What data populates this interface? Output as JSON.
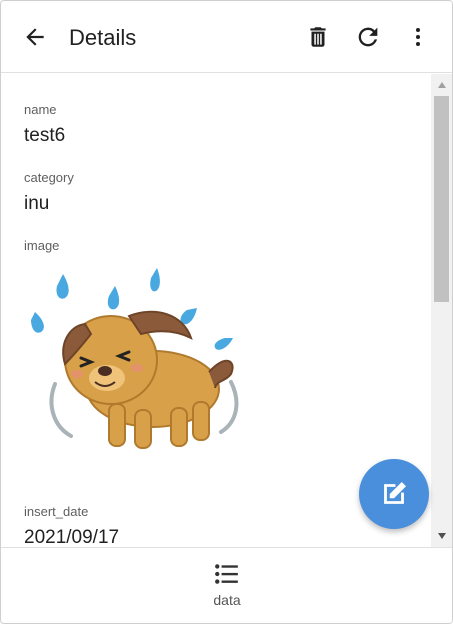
{
  "app": {
    "title": "Details"
  },
  "toolbar": {
    "back_icon": "arrow-back-icon",
    "delete_icon": "trash-icon",
    "refresh_icon": "refresh-icon",
    "more_icon": "more-vert-icon"
  },
  "record": {
    "fields": [
      {
        "label": "name",
        "value": "test6"
      },
      {
        "label": "category",
        "value": "inu"
      },
      {
        "label": "image",
        "value": ""
      },
      {
        "label": "insert_date",
        "value": "2021/09/17"
      }
    ]
  },
  "fab": {
    "icon": "edit-icon",
    "color": "#4a8fdc"
  },
  "bottom_nav": {
    "items": [
      {
        "label": "data",
        "icon": "list-icon"
      }
    ]
  },
  "colors": {
    "accent": "#4a8fdc",
    "droplets": "#4aa8e0",
    "dog_body": "#d9a04a",
    "dog_ears": "#8a5a3a"
  }
}
